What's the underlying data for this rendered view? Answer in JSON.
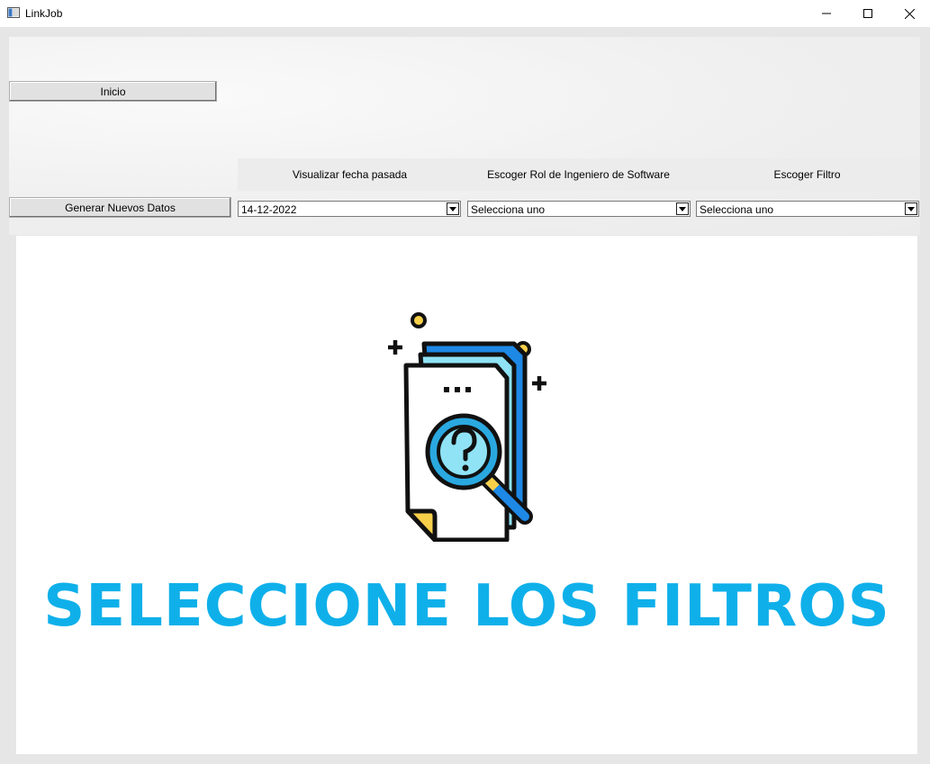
{
  "window": {
    "title": "LinkJob",
    "minimize_icon": "minimize-icon",
    "maximize_icon": "maximize-icon",
    "close_icon": "close-icon"
  },
  "toolbar": {
    "inicio_label": "Inicio",
    "generar_label": "Generar Nuevos Datos",
    "fecha_label": "Visualizar fecha pasada",
    "rol_label": "Escoger Rol de Ingeniero de Software",
    "filtro_label": "Escoger Filtro",
    "fecha_value": "14-12-2022",
    "rol_value": "Selecciona uno",
    "filtro_value": "Selecciona uno"
  },
  "content": {
    "headline": "SELECCIONE LOS FILTROS",
    "illustration_icon": "document-search-question-icon"
  },
  "colors": {
    "accent": "#0fb0ea",
    "blue": "#1e88e5",
    "light_cyan": "#8fe3f5",
    "yellow": "#f7d04a"
  }
}
